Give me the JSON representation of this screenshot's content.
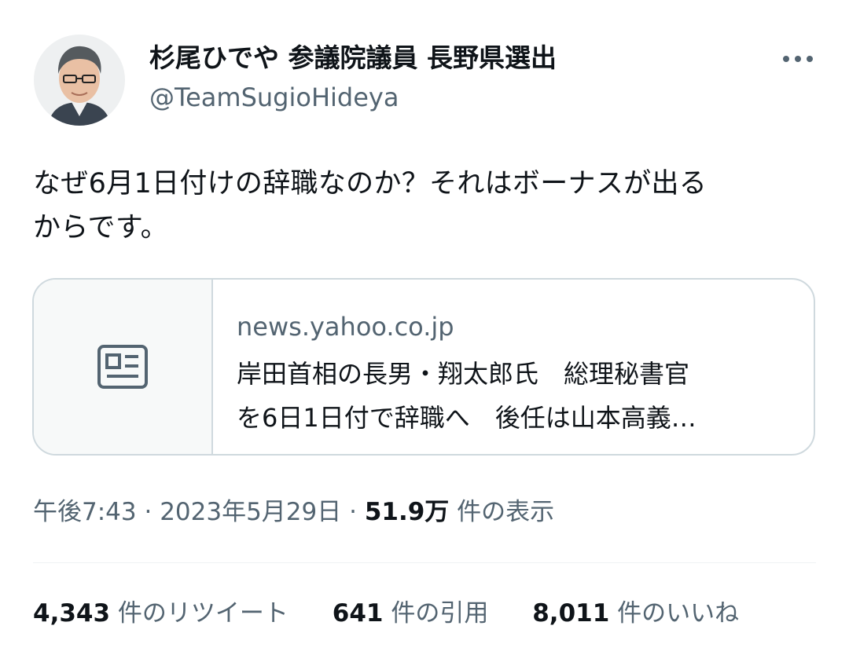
{
  "author": {
    "display_name": "杉尾ひでや 参議院議員 長野県選出",
    "handle": "@TeamSugioHideya"
  },
  "tweet": {
    "text_line1": "なぜ6月1日付けの辞職なのか？それはボーナスが出る",
    "text_line2": "からです。"
  },
  "link_card": {
    "icon": "news-article-icon",
    "domain": "news.yahoo.co.jp",
    "title_line1": "岸田首相の長男・翔太郎氏　総理秘書官",
    "title_line2": "を6日1日付で辞職へ　後任は山本高義…"
  },
  "meta": {
    "time": "午後7:43",
    "sep1": " · ",
    "date": "2023年5月29日",
    "sep2": " · ",
    "views_count": "51.9万",
    "views_label": " 件の表示"
  },
  "stats": {
    "retweets_count": "4,343",
    "retweets_label": " 件のリツイート",
    "quotes_count": "641",
    "quotes_label": " 件の引用",
    "likes_count": "8,011",
    "likes_label": " 件のいいね"
  },
  "colors": {
    "text": "#0f1419",
    "secondary": "#536471",
    "border": "#cfd9de"
  }
}
